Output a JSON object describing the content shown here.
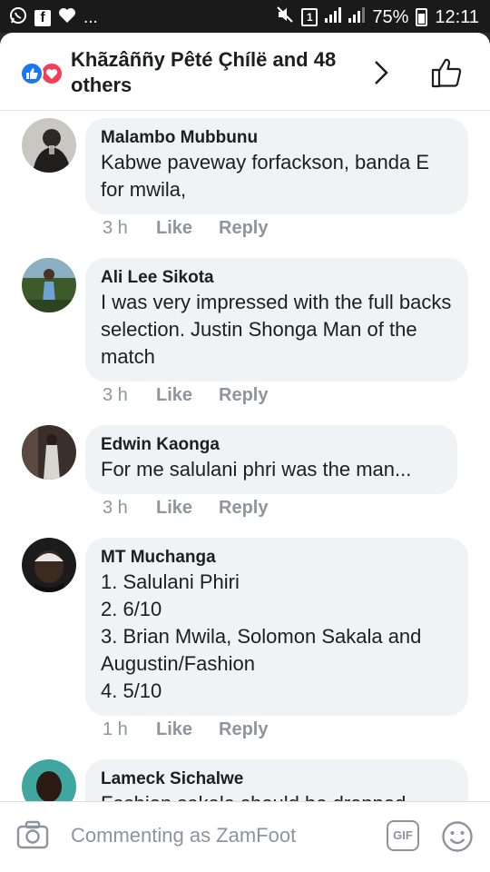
{
  "status_bar": {
    "battery": "75%",
    "time": "12:11",
    "more": "..."
  },
  "header": {
    "title": "Khãzâññy Pêté Çhílë and 48 others"
  },
  "comments": [
    {
      "author": "Malambo Mubbunu",
      "text": "Kabwe paveway forfackson,  banda E for mwila,",
      "time": "3 h",
      "like": "Like",
      "reply": "Reply"
    },
    {
      "author": "Ali Lee Sikota",
      "text": "I was very impressed with the full backs selection. Justin Shonga Man of the match",
      "time": "3 h",
      "like": "Like",
      "reply": "Reply"
    },
    {
      "author": "Edwin Kaonga",
      "text": "For me salulani phri was the man...",
      "time": "3 h",
      "like": "Like",
      "reply": "Reply"
    },
    {
      "author": "MT Muchanga",
      "text": "1. Salulani Phiri\n2. 6/10\n3. Brian Mwila, Solomon Sakala and Augustin/Fashion\n4.  5/10",
      "time": "1 h",
      "like": "Like",
      "reply": "Reply"
    },
    {
      "author": "Lameck Sichalwe",
      "text": "Fashion sakala should be dropped"
    }
  ],
  "composer": {
    "placeholder": "Commenting as ZamFoot",
    "gif_label": "GIF"
  },
  "colors": {
    "like_blue": "#1877f2",
    "love_red": "#f33e58",
    "bubble_bg": "#f0f2f5",
    "meta_gray": "#90949c"
  }
}
